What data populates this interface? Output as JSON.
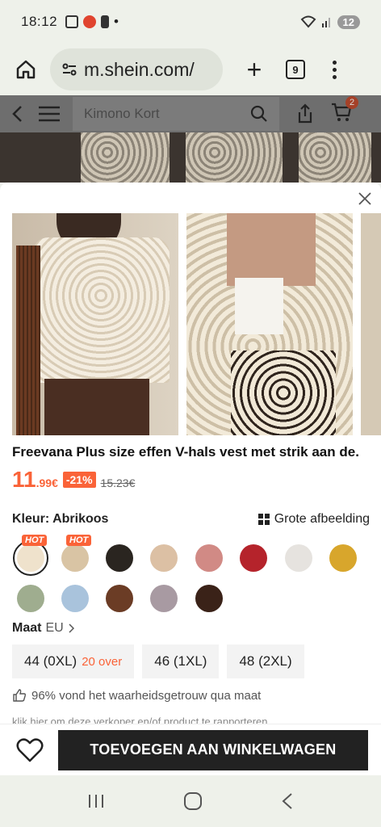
{
  "status": {
    "time": "18:12",
    "dot": "•",
    "battery": "12"
  },
  "browser": {
    "url": "m.shein.com/",
    "tab_count": "9"
  },
  "site": {
    "search_placeholder": "Kimono Kort",
    "cart_badge": "2"
  },
  "product": {
    "title": "Freevana Plus size effen V-hals vest met strik aan de...",
    "price_int": "11",
    "price_dec": ".99€",
    "discount": "-21%",
    "orig_price": "15.23€"
  },
  "color": {
    "label": "Kleur: Abrikoos",
    "big_image": "Grote afbeelding",
    "hot_label": "HOT",
    "swatches": [
      "#efe2cc",
      "#d9c4a4",
      "#2a2520",
      "#dcc0a4",
      "#d18a85",
      "#b5232b",
      "#e6e3df",
      "#d8a62c",
      "#9fad8f",
      "#a9c3dc",
      "#6b3c25",
      "#a89aa2",
      "#3a2218"
    ]
  },
  "size": {
    "label": "Maat",
    "unit": "EU",
    "options": [
      {
        "label": "44 (0XL)",
        "stock": "20 over"
      },
      {
        "label": "46 (1XL)",
        "stock": ""
      },
      {
        "label": "48 (2XL)",
        "stock": ""
      }
    ],
    "fit_text": "96% vond het waarheidsgetrouw qua maat",
    "report_text": "klik hier om deze verkoper en/of product te rapporteren"
  },
  "actions": {
    "add_to_cart": "TOEVOEGEN AAN WINKELWAGEN"
  },
  "colors": {
    "accent": "#fa6338",
    "dark": "#222222"
  }
}
